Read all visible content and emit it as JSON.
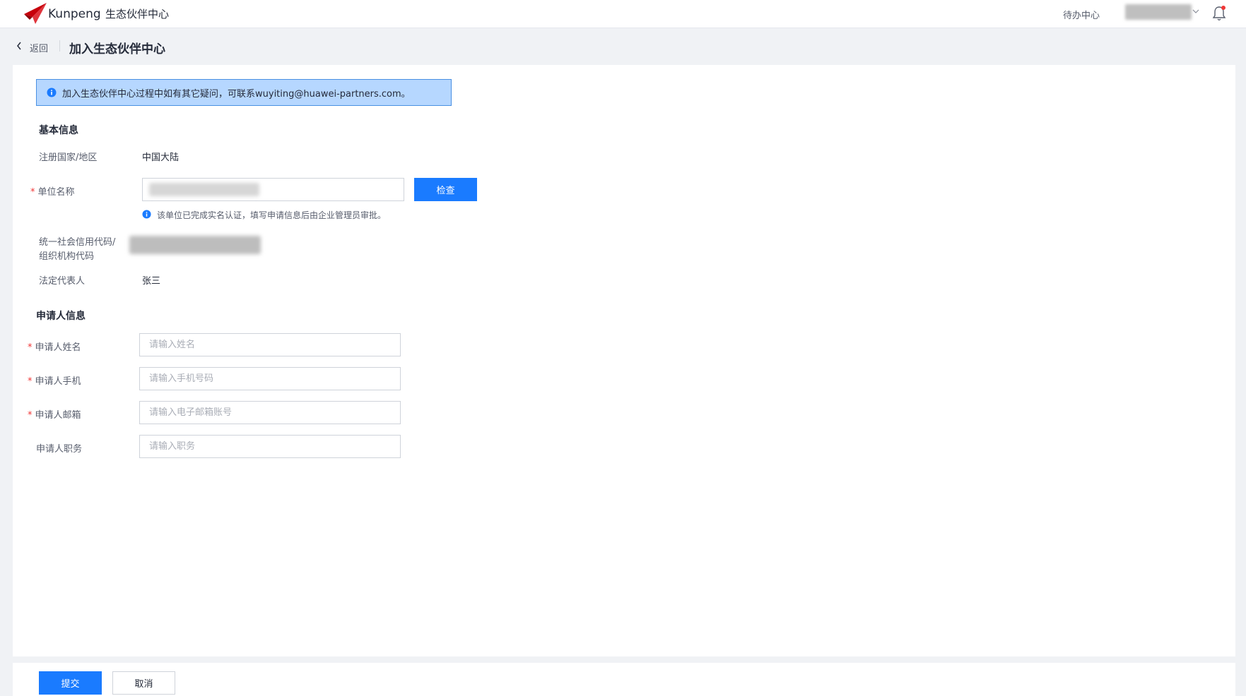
{
  "header": {
    "brand": "Kunpeng",
    "brand_sub": "生态伙伴中心",
    "todo": "待办中心"
  },
  "page": {
    "back_label": "返回",
    "title": "加入生态伙伴中心"
  },
  "notice": {
    "text": "加入生态伙伴中心过程中如有其它疑问，可联系wuyiting@huawei-partners.com。"
  },
  "basic_info": {
    "section_title": "基本信息",
    "country_label": "注册国家/地区",
    "country_value": "中国大陆",
    "org_name_label": "单位名称",
    "check_button": "检查",
    "hint": "该单位已完成实名认证，填写申请信息后由企业管理员审批。",
    "credit_code_label_1": "统一社会信用代码/",
    "credit_code_label_2": "组织机构代码",
    "legal_rep_label": "法定代表人",
    "legal_rep_value": "张三"
  },
  "applicant_info": {
    "section_title": "申请人信息",
    "fields": [
      {
        "label": "申请人姓名",
        "placeholder": "请输入姓名",
        "required": true
      },
      {
        "label": "申请人手机",
        "placeholder": "请输入手机号码",
        "required": true
      },
      {
        "label": "申请人邮箱",
        "placeholder": "请输入电子邮箱账号",
        "required": true
      },
      {
        "label": "申请人职务",
        "placeholder": "请输入职务",
        "required": false
      }
    ]
  },
  "required_mark": "*",
  "footer": {
    "submit": "提交",
    "cancel": "取消"
  },
  "colors": {
    "primary": "#1a7bff",
    "notice_bg": "#b6d7ff",
    "required": "#f03737",
    "logo_red": "#c7000b"
  }
}
